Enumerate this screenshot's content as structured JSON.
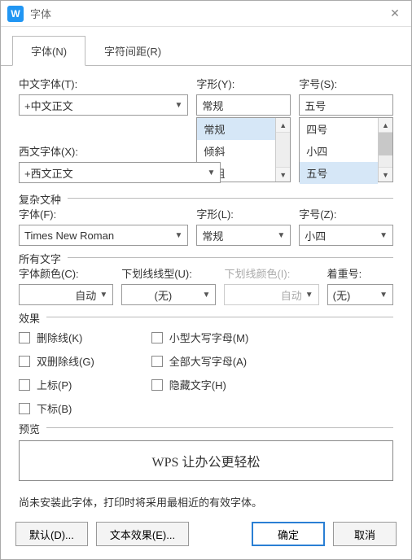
{
  "window": {
    "title": "字体",
    "appGlyph": "W"
  },
  "tabs": {
    "font": "字体(N)",
    "spacing": "字符间距(R)"
  },
  "main": {
    "cjkFont": {
      "label": "中文字体(T):",
      "value": "+中文正文"
    },
    "westFont": {
      "label": "西文字体(X):",
      "value": "+西文正文"
    },
    "style": {
      "label": "字形(Y):",
      "value": "常规",
      "options": [
        "常规",
        "倾斜",
        "加粗"
      ]
    },
    "size": {
      "label": "字号(S):",
      "value": "五号",
      "options": [
        "四号",
        "小四",
        "五号"
      ]
    }
  },
  "complex": {
    "legend": "复杂文种",
    "font": {
      "label": "字体(F):",
      "value": "Times New Roman"
    },
    "style": {
      "label": "字形(L):",
      "value": "常规"
    },
    "size": {
      "label": "字号(Z):",
      "value": "小四"
    }
  },
  "allText": {
    "legend": "所有文字",
    "color": {
      "label": "字体颜色(C):",
      "value": "自动"
    },
    "underline": {
      "label": "下划线线型(U):",
      "value": "(无)"
    },
    "underlineColor": {
      "label": "下划线颜色(I):",
      "value": "自动"
    },
    "emphasis": {
      "label": "着重号:",
      "value": "(无)"
    }
  },
  "effects": {
    "legend": "效果",
    "strike": "删除线(K)",
    "dblStrike": "双删除线(G)",
    "superscript": "上标(P)",
    "subscript": "下标(B)",
    "smallCaps": "小型大写字母(M)",
    "allCaps": "全部大写字母(A)",
    "hidden": "隐藏文字(H)"
  },
  "preview": {
    "legend": "预览",
    "text": "WPS 让办公更轻松"
  },
  "note": "尚未安装此字体，打印时将采用最相近的有效字体。",
  "footer": {
    "default": "默认(D)...",
    "textEffects": "文本效果(E)...",
    "ok": "确定",
    "cancel": "取消"
  }
}
